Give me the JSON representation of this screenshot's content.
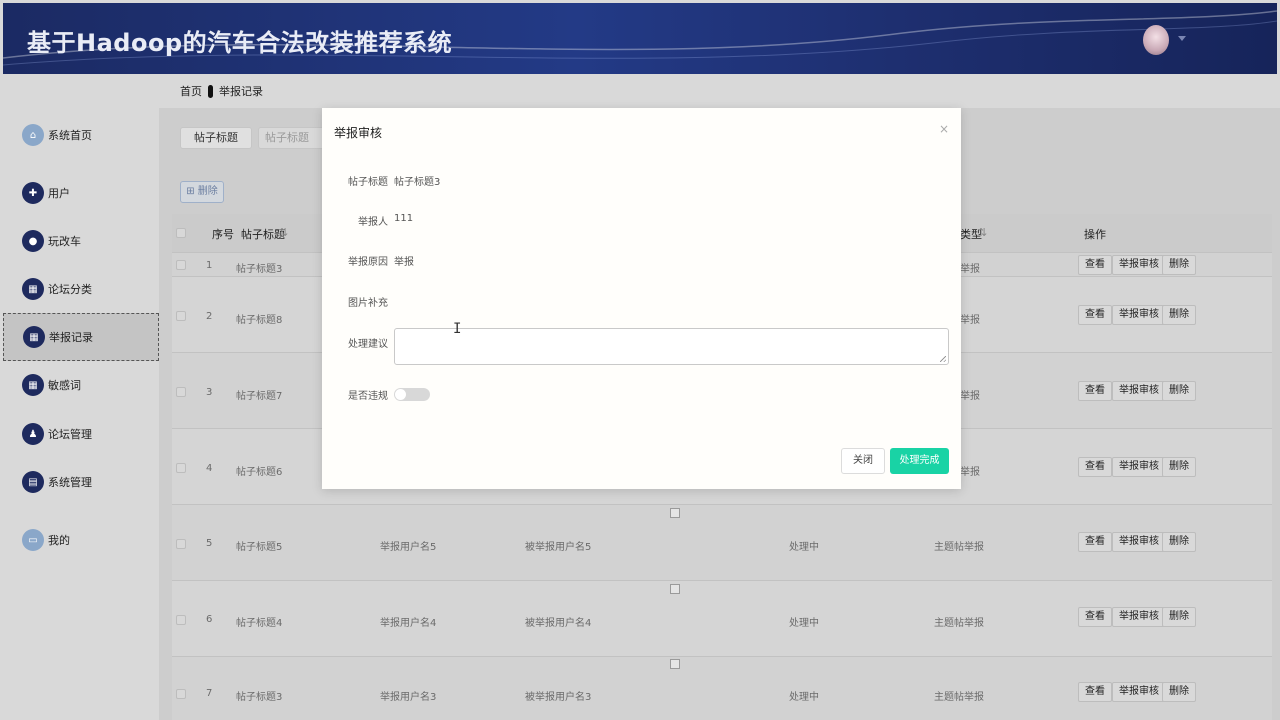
{
  "header": {
    "title": "基于Hadoop的汽车合法改装推荐系统"
  },
  "breadcrumb": {
    "home": "首页",
    "current": "举报记录"
  },
  "sidebar": {
    "items": [
      {
        "label": "系统首页",
        "icon": "home-icon"
      },
      {
        "label": "用户",
        "icon": "user-icon"
      },
      {
        "label": "玩改车",
        "icon": "location-pin-icon"
      },
      {
        "label": "论坛分类",
        "icon": "grid-icon"
      },
      {
        "label": "举报记录",
        "icon": "grid-icon",
        "active": true
      },
      {
        "label": "敏感词",
        "icon": "grid-icon"
      },
      {
        "label": "论坛管理",
        "icon": "person-icon"
      },
      {
        "label": "系统管理",
        "icon": "document-icon"
      },
      {
        "label": "我的",
        "icon": "calendar-icon"
      }
    ]
  },
  "search": {
    "label": "帖子标题",
    "placeholder": "帖子标题"
  },
  "toolbar": {
    "delete_label": "删除"
  },
  "table": {
    "headers": {
      "index": "序号",
      "title": "帖子标题",
      "type": "类型",
      "ops": "操作"
    },
    "rows": [
      {
        "no": "1",
        "title": "帖子标题3",
        "reporter": "",
        "reported": "",
        "status": "",
        "type": "举报"
      },
      {
        "no": "2",
        "title": "帖子标题8",
        "reporter": "",
        "reported": "",
        "status": "",
        "type": "举报"
      },
      {
        "no": "3",
        "title": "帖子标题7",
        "reporter": "",
        "reported": "",
        "status": "",
        "type": "举报"
      },
      {
        "no": "4",
        "title": "帖子标题6",
        "reporter": "",
        "reported": "",
        "status": "",
        "type": "举报"
      },
      {
        "no": "5",
        "title": "帖子标题5",
        "reporter": "举报用户名5",
        "reported": "被举报用户名5",
        "status": "处理中",
        "type": "主题帖举报"
      },
      {
        "no": "6",
        "title": "帖子标题4",
        "reporter": "举报用户名4",
        "reported": "被举报用户名4",
        "status": "处理中",
        "type": "主题帖举报"
      },
      {
        "no": "7",
        "title": "帖子标题3",
        "reporter": "举报用户名3",
        "reported": "被举报用户名3",
        "status": "处理中",
        "type": "主题帖举报"
      }
    ],
    "ops": {
      "view": "查看",
      "review": "举报审核",
      "delete": "删除"
    }
  },
  "modal": {
    "title": "举报审核",
    "close_symbol": "×",
    "fields": {
      "post_title_label": "帖子标题",
      "post_title_value": "帖子标题3",
      "reporter_label": "举报人",
      "reporter_value": "111",
      "reason_label": "举报原因",
      "reason_value": "举报",
      "image_label": "图片补充",
      "advice_label": "处理建议",
      "violation_label": "是否违规"
    },
    "violation_on": false,
    "buttons": {
      "close": "关闭",
      "done": "处理完成"
    },
    "colors": {
      "done_button": "#19d3a5"
    }
  }
}
